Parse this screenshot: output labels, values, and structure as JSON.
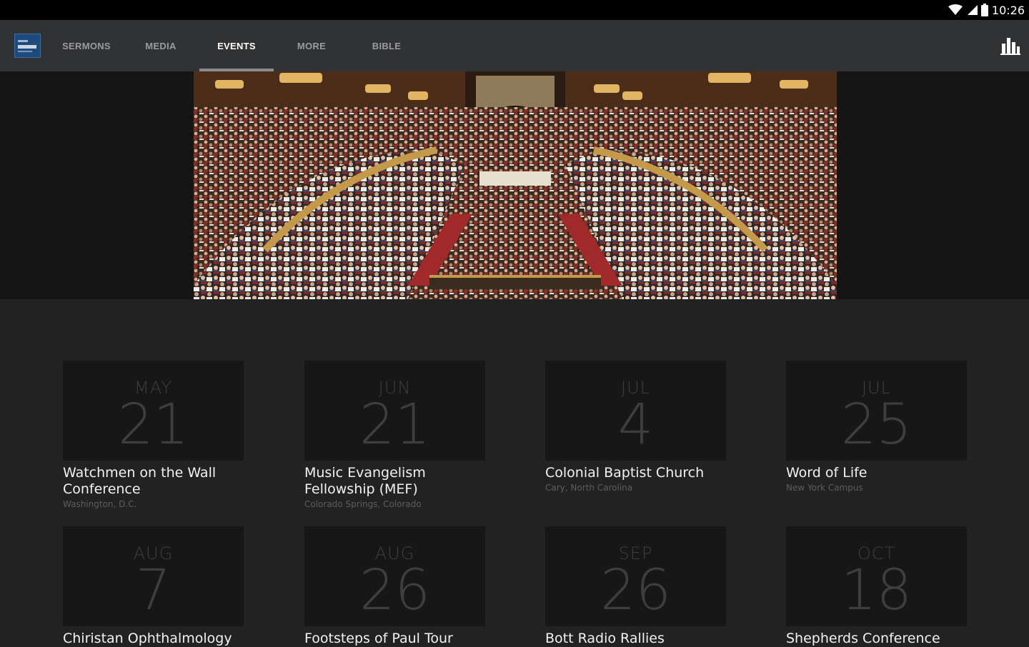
{
  "status_bar": {
    "time": "10:26"
  },
  "nav": {
    "tabs": [
      {
        "label": "SERMONS"
      },
      {
        "label": "MEDIA"
      },
      {
        "label": "EVENTS"
      },
      {
        "label": "MORE"
      },
      {
        "label": "BIBLE"
      }
    ],
    "active_tab": "EVENTS"
  },
  "events": [
    {
      "month": "MAY",
      "day": "21",
      "title": "Watchmen on the Wall Conference",
      "location": "Washington, D.C."
    },
    {
      "month": "JUN",
      "day": "21",
      "title": "Music Evangelism Fellowship (MEF)",
      "location": "Colorado Springs, Colorado"
    },
    {
      "month": "JUL",
      "day": "4",
      "title": "Colonial Baptist Church",
      "location": "Cary, North Carolina"
    },
    {
      "month": "JUL",
      "day": "25",
      "title": "Word of Life",
      "location": "New York Campus"
    },
    {
      "month": "AUG",
      "day": "7",
      "title": "Chiristan Ophthalmology",
      "location": ""
    },
    {
      "month": "AUG",
      "day": "26",
      "title": "Footsteps of Paul Tour",
      "location": ""
    },
    {
      "month": "SEP",
      "day": "26",
      "title": "Bott Radio Rallies",
      "location": ""
    },
    {
      "month": "OCT",
      "day": "18",
      "title": "Shepherds Conference",
      "location": ""
    }
  ],
  "colors": {
    "status_bar": "#000000",
    "app_bar": "#313233",
    "background": "#222223",
    "date_box": "#171718",
    "date_text": "#3d3e3f",
    "logo": "#1e4a7c"
  },
  "icons": {
    "wifi": "wifi-icon",
    "signal": "signal-icon",
    "battery": "battery-icon",
    "chart": "bar-chart-icon"
  }
}
